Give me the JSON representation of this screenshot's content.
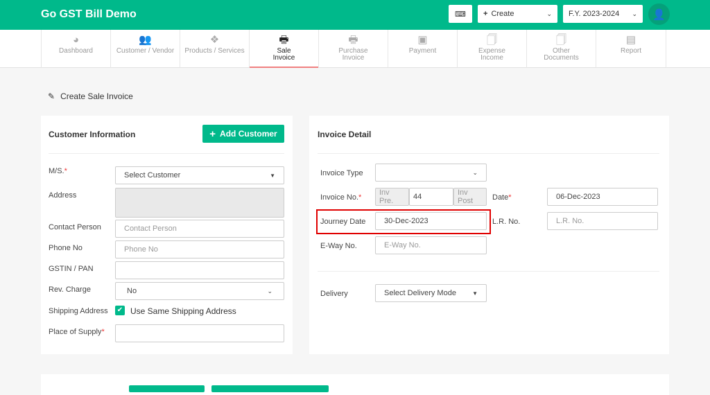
{
  "header": {
    "title": "Go GST Bill Demo",
    "create_label": "Create",
    "fy_label": "F.Y. 2023-2024"
  },
  "nav": [
    {
      "label": "Dashboard",
      "icon": "dashboard-icon"
    },
    {
      "label": "Customer / Vendor",
      "icon": "users-icon"
    },
    {
      "label": "Products / Services",
      "icon": "cubes-icon"
    },
    {
      "label": "Sale Invoice",
      "icon": "printer-icon",
      "active": true
    },
    {
      "label": "Purchase Invoice",
      "icon": "printer-icon"
    },
    {
      "label": "Payment",
      "icon": "money-icon"
    },
    {
      "label": "Expense Income",
      "icon": "files-icon"
    },
    {
      "label": "Other Documents",
      "icon": "files-icon"
    },
    {
      "label": "Report",
      "icon": "newspaper-icon"
    }
  ],
  "page_title": "Create Sale Invoice",
  "customer": {
    "heading": "Customer Information",
    "add_button": "Add Customer",
    "ms_label": "M/S.",
    "ms_value": "Select Customer",
    "address_label": "Address",
    "contact_label": "Contact Person",
    "contact_placeholder": "Contact Person",
    "phone_label": "Phone No",
    "phone_placeholder": "Phone No",
    "gstin_label": "GSTIN / PAN",
    "rev_label": "Rev. Charge",
    "rev_value": "No",
    "shipping_label": "Shipping Address",
    "shipping_checkbox": "Use Same Shipping Address",
    "supply_label": "Place of Supply"
  },
  "invoice": {
    "heading": "Invoice Detail",
    "type_label": "Invoice Type",
    "no_label": "Invoice No.",
    "prefix": "Inv Pre.",
    "number": "44",
    "postfix": "Inv Post",
    "date_label": "Date",
    "date_value": "06-Dec-2023",
    "journey_label": "Journey Date",
    "journey_value": "30-Dec-2023",
    "lr_label": "L.R. No.",
    "lr_placeholder": "L.R. No.",
    "eway_label": "E-Way No.",
    "eway_placeholder": "E-Way No.",
    "delivery_label": "Delivery",
    "delivery_value": "Select Delivery Mode"
  },
  "colors": {
    "brand": "#00b98b",
    "highlight": "#e00000"
  }
}
